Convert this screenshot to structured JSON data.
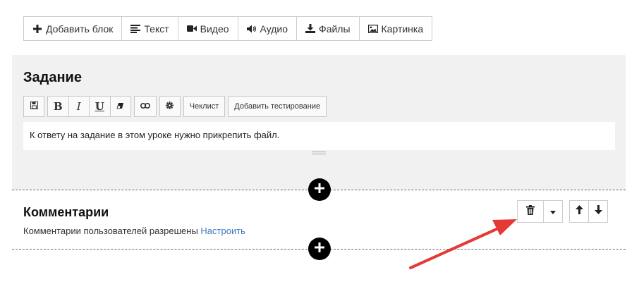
{
  "toolbar": {
    "items": [
      {
        "label": "Добавить блок",
        "icon": "plus-icon"
      },
      {
        "label": "Текст",
        "icon": "text-lines-icon"
      },
      {
        "label": "Видео",
        "icon": "video-camera-icon"
      },
      {
        "label": "Аудио",
        "icon": "speaker-icon"
      },
      {
        "label": "Файлы",
        "icon": "download-icon"
      },
      {
        "label": "Картинка",
        "icon": "image-icon"
      }
    ]
  },
  "task": {
    "title": "Задание",
    "editor": {
      "buttons": {
        "save_icon": "floppy-disk-icon",
        "bold": "B",
        "italic": "I",
        "underline": "U",
        "eraser_icon": "eraser-icon",
        "link_icon": "link-icon",
        "settings_icon": "gear-icon",
        "checklist": "Чеклист",
        "add_test": "Добавить тестирование"
      },
      "content": "К ответу на задание в этом уроке нужно прикрепить файл."
    }
  },
  "add_block_icon": "plus-circle-icon",
  "comments": {
    "title": "Комментарии",
    "status": "Комментарии пользователей разрешены",
    "configure_link": "Настроить",
    "controls": {
      "delete_icon": "trash-icon",
      "dropdown_icon": "caret-down-icon",
      "move_up_icon": "arrow-up-icon",
      "move_down_icon": "arrow-down-icon"
    }
  },
  "colors": {
    "block_bg": "#f1f1f1",
    "link": "#3b7bbf",
    "annotation_arrow": "#e53935"
  }
}
